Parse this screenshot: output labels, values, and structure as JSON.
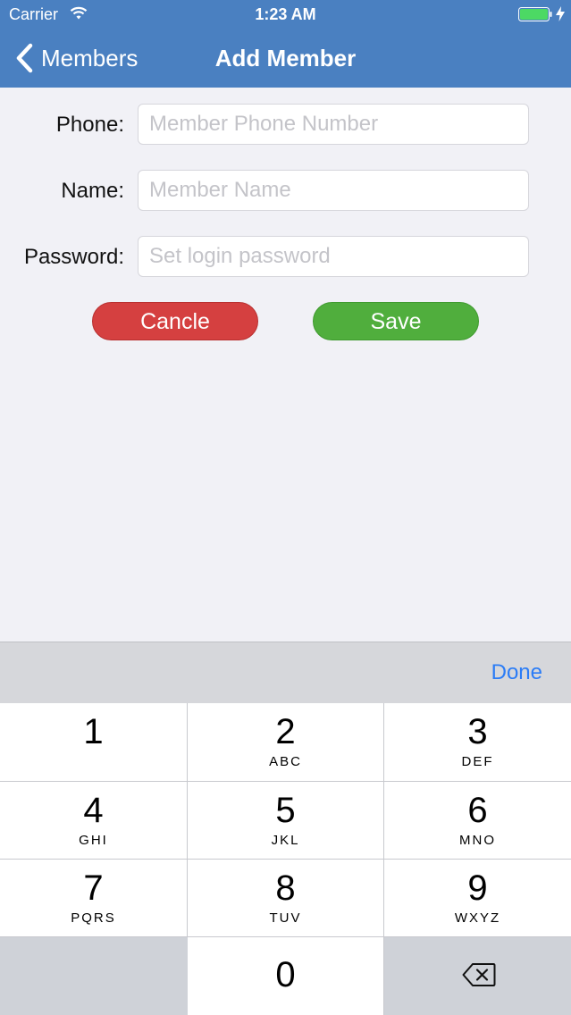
{
  "status_bar": {
    "carrier": "Carrier",
    "time": "1:23 AM"
  },
  "nav": {
    "back_label": "Members",
    "title": "Add Member"
  },
  "form": {
    "phone": {
      "label": "Phone:",
      "placeholder": "Member Phone Number",
      "value": ""
    },
    "name": {
      "label": "Name:",
      "placeholder": "Member Name",
      "value": ""
    },
    "password": {
      "label": "Password:",
      "placeholder": "Set login password",
      "value": ""
    }
  },
  "buttons": {
    "cancel_label": "Cancle",
    "save_label": "Save"
  },
  "keyboard": {
    "done_label": "Done",
    "keys": [
      {
        "digit": "1",
        "letters": ""
      },
      {
        "digit": "2",
        "letters": "ABC"
      },
      {
        "digit": "3",
        "letters": "DEF"
      },
      {
        "digit": "4",
        "letters": "GHI"
      },
      {
        "digit": "5",
        "letters": "JKL"
      },
      {
        "digit": "6",
        "letters": "MNO"
      },
      {
        "digit": "7",
        "letters": "PQRS"
      },
      {
        "digit": "8",
        "letters": "TUV"
      },
      {
        "digit": "9",
        "letters": "WXYZ"
      },
      {
        "digit": "0",
        "letters": ""
      }
    ]
  },
  "colors": {
    "nav_background": "#4a80c1",
    "cancel_button": "#d54040",
    "save_button": "#50ae3d",
    "done_text": "#2b7cf6",
    "battery_fill": "#4cd964"
  },
  "icons": {
    "wifi": "wifi-icon",
    "battery": "battery-icon",
    "charging": "bolt-icon",
    "back": "chevron-left-icon",
    "delete": "backspace-icon"
  }
}
